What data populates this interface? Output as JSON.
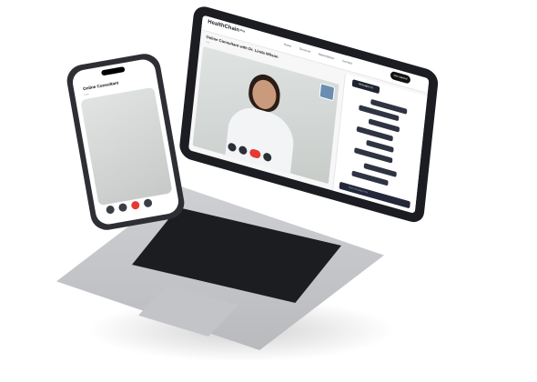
{
  "brand": {
    "name": "HealthChain",
    "suffix": "Pro"
  },
  "nav": {
    "items": [
      "Home",
      "Services",
      "Marketplace",
      "Contact"
    ],
    "cta": "Get started"
  },
  "consultation": {
    "title": "Online Consultant with Dr. Linda Wilson",
    "badge": "Live",
    "chat_header": "Messages (1)",
    "chat_placeholder": "Write message here"
  },
  "mobile": {
    "title": "Online Consultant",
    "subtitle": "Live"
  },
  "icons": [
    "back-icon",
    "mute-icon",
    "camera-icon",
    "end-call-icon",
    "more-icon",
    "send-icon"
  ],
  "colors": {
    "accent": "#1f2430",
    "danger": "#e53935",
    "device": "#1b1d22"
  }
}
